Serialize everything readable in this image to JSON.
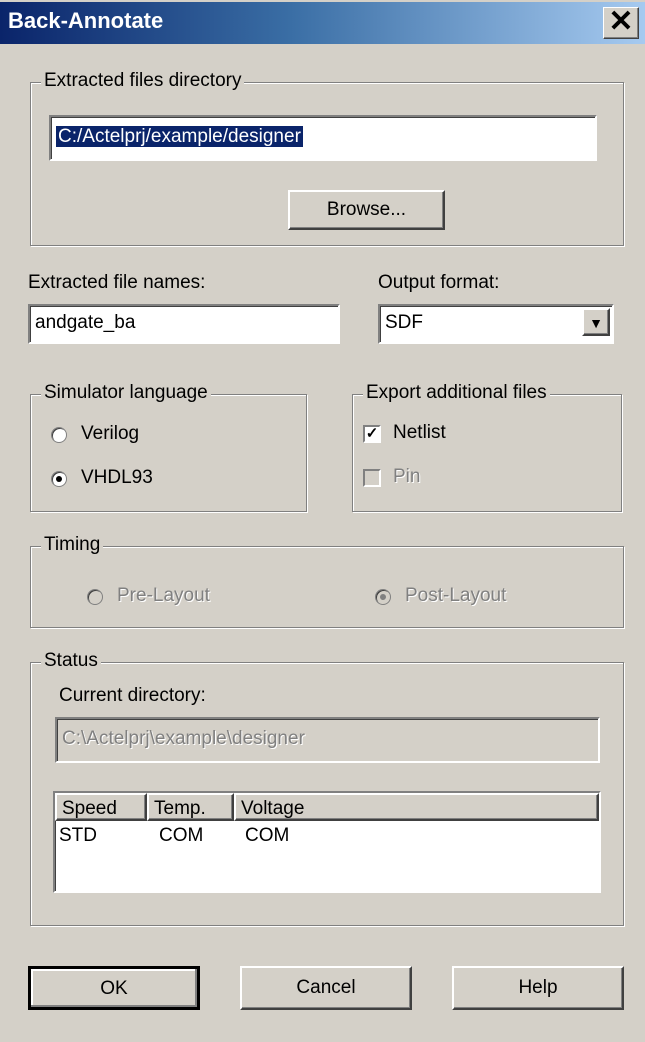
{
  "dialog": {
    "title": "Back-Annotate",
    "close_glyph": "✕"
  },
  "extracted_dir": {
    "legend": "Extracted files directory",
    "value": "C:/Actelprj/example/designer",
    "browse_label": "Browse..."
  },
  "file_names": {
    "label": "Extracted file names:",
    "value": "andgate_ba"
  },
  "output_format": {
    "label": "Output format:",
    "value": "SDF",
    "arrow": "▼"
  },
  "simulator": {
    "legend": "Simulator language",
    "options": [
      "Verilog",
      "VHDL93"
    ],
    "selected": "VHDL93"
  },
  "export": {
    "legend": "Export additional files",
    "netlist_label": "Netlist",
    "netlist_checked": true,
    "pin_label": "Pin",
    "pin_checked": false,
    "check_mark": "✓"
  },
  "timing": {
    "legend": "Timing",
    "pre_label": "Pre-Layout",
    "post_label": "Post-Layout",
    "selected": "Post-Layout"
  },
  "status": {
    "legend": "Status",
    "current_dir_label": "Current directory:",
    "current_dir_value": "C:\\Actelprj\\example\\designer",
    "table": {
      "headers": [
        "Speed",
        "Temp.",
        "Voltage"
      ],
      "rows": [
        [
          "STD",
          "COM",
          "COM"
        ]
      ]
    }
  },
  "buttons": {
    "ok": "OK",
    "cancel": "Cancel",
    "help": "Help"
  }
}
